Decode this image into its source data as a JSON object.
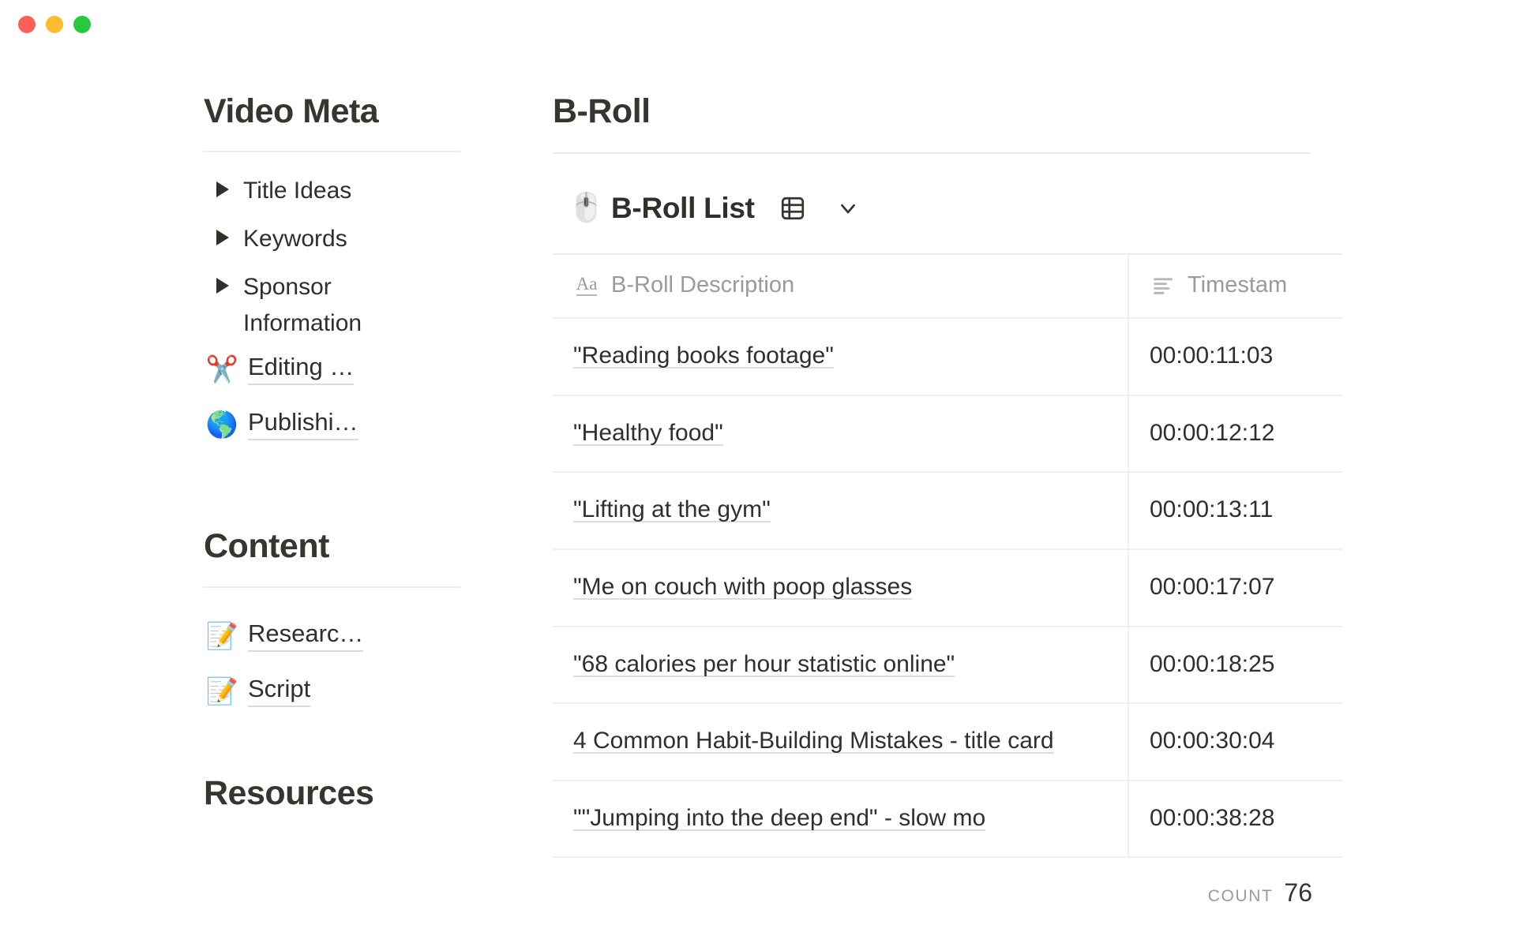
{
  "window": {
    "controls": [
      {
        "name": "close",
        "color": "#ff5f57"
      },
      {
        "name": "minimize",
        "color": "#febc2e"
      },
      {
        "name": "maximize",
        "color": "#28c840"
      }
    ]
  },
  "sidebar": {
    "sections": [
      {
        "title": "Video Meta",
        "toggles": [
          {
            "label": "Title Ideas"
          },
          {
            "label": "Keywords"
          },
          {
            "label": "Sponsor Information"
          }
        ],
        "links": [
          {
            "emoji": "✂️",
            "icon_name": "scissors-icon",
            "label": "Editing …"
          },
          {
            "emoji": "🌎",
            "icon_name": "globe-icon",
            "label": "Publishi…"
          }
        ]
      },
      {
        "title": "Content",
        "toggles": [],
        "links": [
          {
            "emoji": "📝",
            "icon_name": "memo-icon",
            "label": "Researc…"
          },
          {
            "emoji": "📝",
            "icon_name": "memo-icon",
            "label": "Script"
          }
        ]
      },
      {
        "title": "Resources",
        "toggles": [],
        "links": []
      }
    ]
  },
  "main": {
    "page_title": "B-Roll",
    "database": {
      "emoji": "🖱️",
      "emoji_icon_name": "computer-mouse-icon",
      "title": "B-Roll List",
      "view_icon_name": "table-view-icon",
      "chevron_icon_name": "chevron-down-icon"
    },
    "table": {
      "columns": [
        {
          "label": "B-Roll Description",
          "icon_name": "text-type-icon",
          "icon_glyph": "Aa"
        },
        {
          "label": "Timestam",
          "icon_name": "align-left-icon",
          "icon_glyph": ""
        }
      ],
      "rows": [
        {
          "description": "\"Reading books footage\"",
          "timestamp": "00:00:11:03"
        },
        {
          "description": "\"Healthy food\"",
          "timestamp": "00:00:12:12"
        },
        {
          "description": "\"Lifting at the gym\"",
          "timestamp": "00:00:13:11"
        },
        {
          "description": "\"Me on couch with poop glasses",
          "timestamp": "00:00:17:07"
        },
        {
          "description": "\"68 calories per hour statistic online\"",
          "timestamp": "00:00:18:25"
        },
        {
          "description": "4 Common Habit-Building Mistakes - title card",
          "timestamp": "00:00:30:04"
        },
        {
          "description": "\"\"Jumping into the deep end\" - slow mo",
          "timestamp": "00:00:38:28"
        }
      ],
      "footer": {
        "count_label": "COUNT",
        "count_value": "76"
      }
    }
  }
}
